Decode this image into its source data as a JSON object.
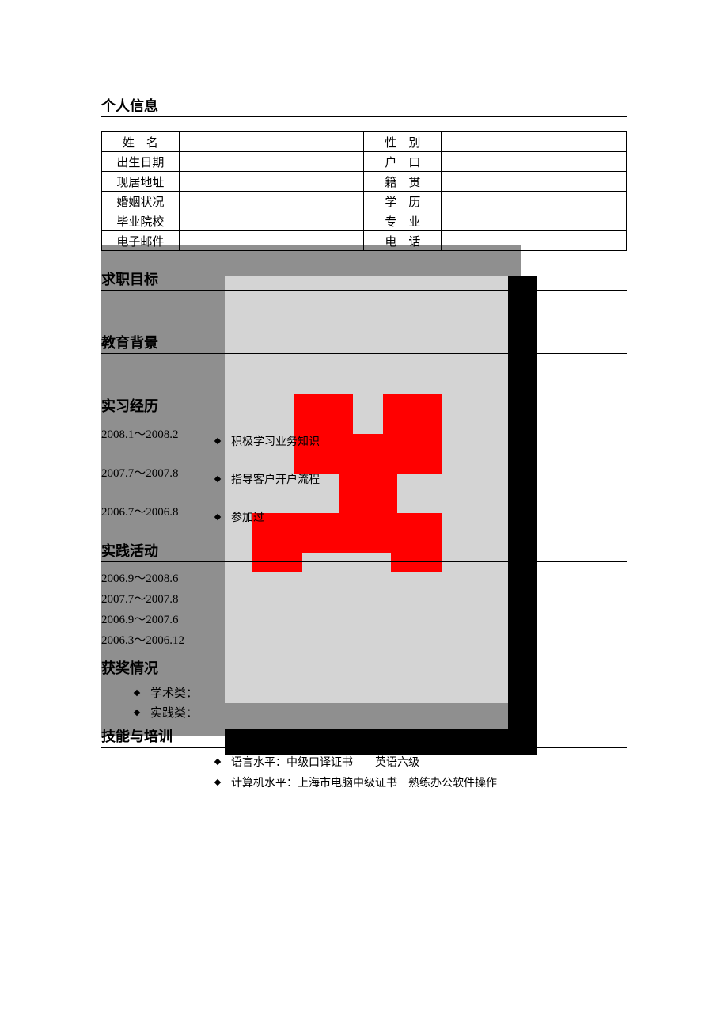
{
  "sections": {
    "personal": "个人信息",
    "objective": "求职目标",
    "education": "教育背景",
    "internship": "实习经历",
    "activities": "实践活动",
    "awards": "获奖情况",
    "skills": "技能与培训"
  },
  "info_labels": {
    "name": "姓　名",
    "gender": "性　别",
    "birth": "出生日期",
    "hukou": "户　口",
    "address": "现居地址",
    "native": "籍　贯",
    "marital": "婚姻状况",
    "degree": "学　历",
    "school": "毕业院校",
    "major": "专　业",
    "email": "电子邮件",
    "phone": "电　话"
  },
  "internship": {
    "dates": [
      "2008.1～2008.2",
      "2007.7～2007.8",
      "2006.7～2006.8"
    ],
    "bullets": [
      "积极学习业务知识",
      "指导客户开户流程",
      "参加过"
    ]
  },
  "activities": {
    "dates": [
      "2006.9～2008.6",
      "2007.7～2007.8",
      "2006.9～2007.6",
      "2006.3～2006.12"
    ]
  },
  "awards": {
    "items": [
      "学术类：",
      "实践类："
    ]
  },
  "skills": {
    "items": [
      "语言水平：中级口译证书　　英语六级",
      "计算机水平：上海市电脑中级证书　熟练办公软件操作"
    ]
  }
}
